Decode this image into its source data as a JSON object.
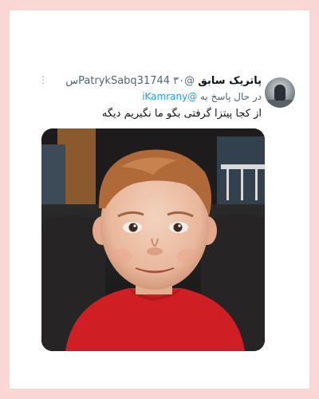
{
  "tweet": {
    "display_name": "پاتریک سابق",
    "handle": "@PatrykSabq31744",
    "time": "۳۰س",
    "reply_prefix": "در حال پاسخ به",
    "reply_to": "@iKamrany",
    "text": "از کجا پیتزا گرفتی بگو ما نگیریم دیگه",
    "more_icon": "more-horizontal-icon"
  },
  "colors": {
    "frame": "#f8d7d5",
    "card": "#ffffff",
    "text": "#0f1419",
    "secondary": "#536471",
    "link": "#1d9bf0"
  }
}
